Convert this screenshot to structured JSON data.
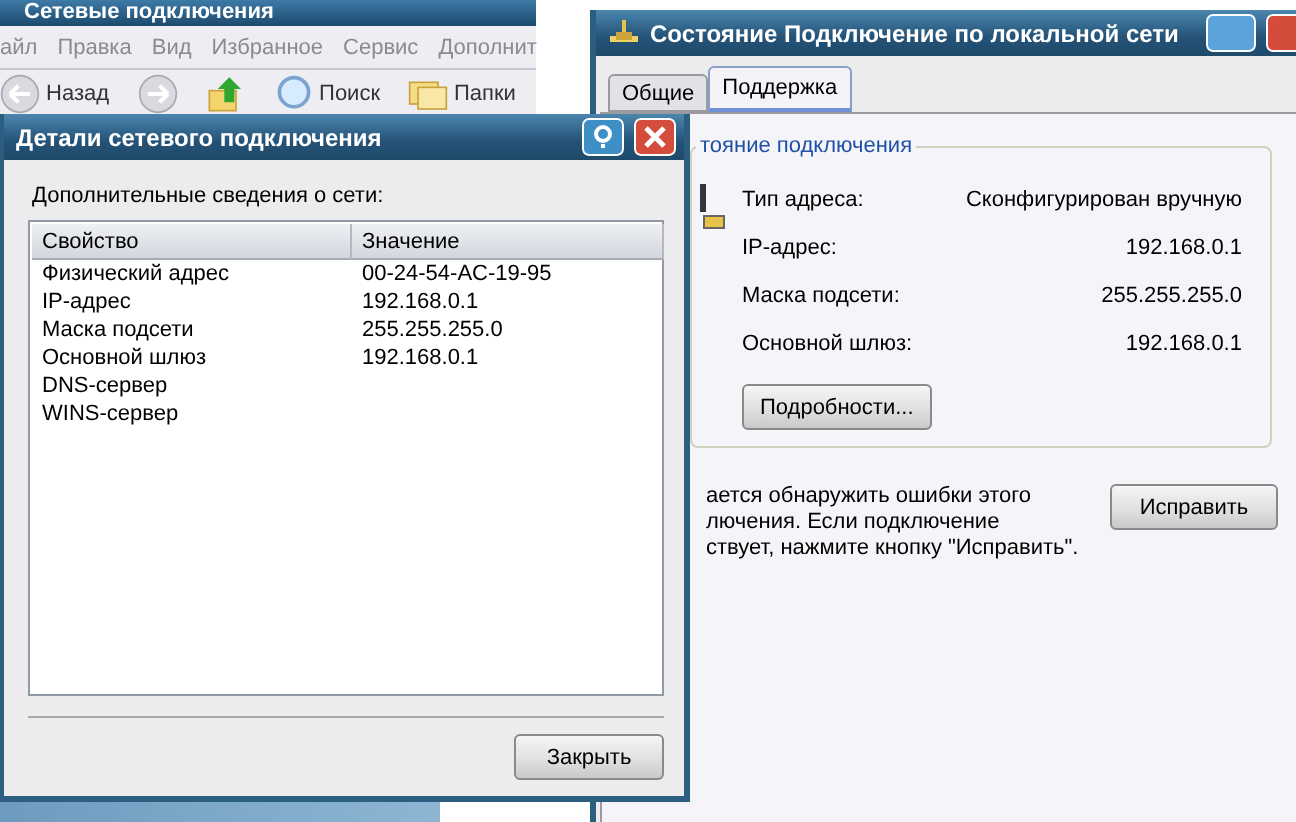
{
  "explorer": {
    "title": "Сетевые подключения",
    "menu": [
      "айл",
      "Правка",
      "Вид",
      "Избранное",
      "Сервис",
      "Дополнит"
    ],
    "toolbar": [
      {
        "kind": "back",
        "label": "Назад"
      },
      {
        "kind": "forward"
      },
      {
        "kind": "up"
      },
      {
        "kind": "search",
        "label": "Поиск"
      },
      {
        "kind": "folders",
        "label": "Папки"
      }
    ]
  },
  "status_window": {
    "title": "Состояние Подключение по локальной сети",
    "tabs": [
      {
        "label": "Общие",
        "selected": false
      },
      {
        "label": "Поддержка",
        "selected": true
      }
    ],
    "group": {
      "title": "тояние подключения",
      "rows": [
        {
          "label": "Тип адреса:",
          "value": "Сконфигурирован вручную"
        },
        {
          "label": "IP-адрес:",
          "value": "192.168.0.1"
        },
        {
          "label": "Маска подсети:",
          "value": "255.255.255.0"
        },
        {
          "label": "Основной шлюз:",
          "value": "192.168.0.1"
        }
      ],
      "details_button": "Подробности..."
    },
    "repair_text": "ается обнаружить ошибки этого\nлючения. Если подключение\nствует, нажмите кнопку \"Исправить\".",
    "repair_button": "Исправить"
  },
  "details_dialog": {
    "title": "Детали сетевого подключения",
    "caption": "Дополнительные сведения о сети:",
    "columns": [
      "Свойство",
      "Значение"
    ],
    "rows": [
      {
        "property": "Физический адрес",
        "value": "00-24-54-AC-19-95"
      },
      {
        "property": "IP-адрес",
        "value": "192.168.0.1"
      },
      {
        "property": "Маска подсети",
        "value": "255.255.255.0"
      },
      {
        "property": "Основной шлюз",
        "value": "192.168.0.1"
      },
      {
        "property": "DNS-сервер"
      },
      {
        "property": "WINS-сервер"
      }
    ],
    "close_button": "Закрыть"
  }
}
